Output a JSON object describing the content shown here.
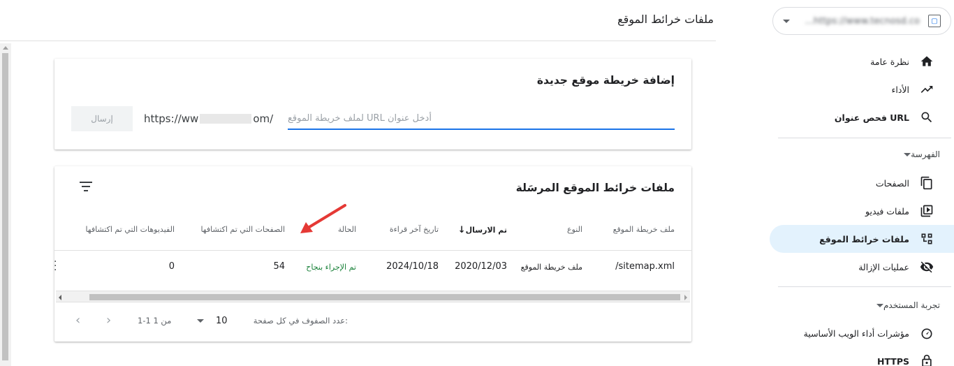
{
  "header": {
    "title": "ملفات خرائط الموقع"
  },
  "property": {
    "url": "https://www.tecnosd.co..."
  },
  "sidebar": {
    "items": [
      {
        "label": "نظرة عامة",
        "icon": "home-icon"
      },
      {
        "label": "الأداء",
        "icon": "trending-up-icon"
      },
      {
        "label": "فحص عنوان URL",
        "icon": "search-icon"
      }
    ],
    "index_section": "الفهرسة",
    "index_items": [
      {
        "label": "الصفحات",
        "icon": "pages-icon"
      },
      {
        "label": "ملفات فيديو",
        "icon": "video-icon"
      },
      {
        "label": "ملفات خرائط الموقع",
        "icon": "sitemap-icon"
      },
      {
        "label": "عمليات الإزالة",
        "icon": "visibility-off-icon"
      }
    ],
    "ux_section": "تجربة المستخدم",
    "ux_items": [
      {
        "label": "مؤشرات أداء الويب الأساسية",
        "icon": "gauge-icon"
      },
      {
        "label": "HTTPS",
        "icon": "lock-icon"
      }
    ]
  },
  "add_card": {
    "title": "إضافة خريطة موقع جديدة",
    "url_prefix_start": "https://ww",
    "url_prefix_end": "om/",
    "input_placeholder": "أدخل عنوان URL لملف خريطة الموقع",
    "submit_label": "إرسال"
  },
  "submitted_card": {
    "title": "ملفات خرائط الموقع المرسَلة",
    "columns": {
      "sitemap": "ملف خريطة الموقع",
      "type": "النوع",
      "submitted": "تم الارسال",
      "last_read": "تاريخ آخر قراءة",
      "status": "الحالة",
      "pages": "الصفحات التي تم اكتشافها",
      "videos": "الفيديوهات التي تم اكتشافها"
    },
    "rows": [
      {
        "sitemap": "/sitemap.xml",
        "type": "ملف خريطة الموقع",
        "submitted": "2020/12/03",
        "last_read": "2024/10/18",
        "status": "تم الإجراء بنجاح",
        "pages": "54",
        "videos": "0"
      }
    ],
    "pagination": {
      "rows_per_page_label": "عدد الصفوف في كل صفحة:",
      "rows_per_page": "10",
      "range": "1-1 من 1"
    }
  },
  "colors": {
    "accent": "#1a73e8",
    "active_nav": "#e3f2fd",
    "success": "#188038",
    "annotation_arrow": "#e53935"
  }
}
